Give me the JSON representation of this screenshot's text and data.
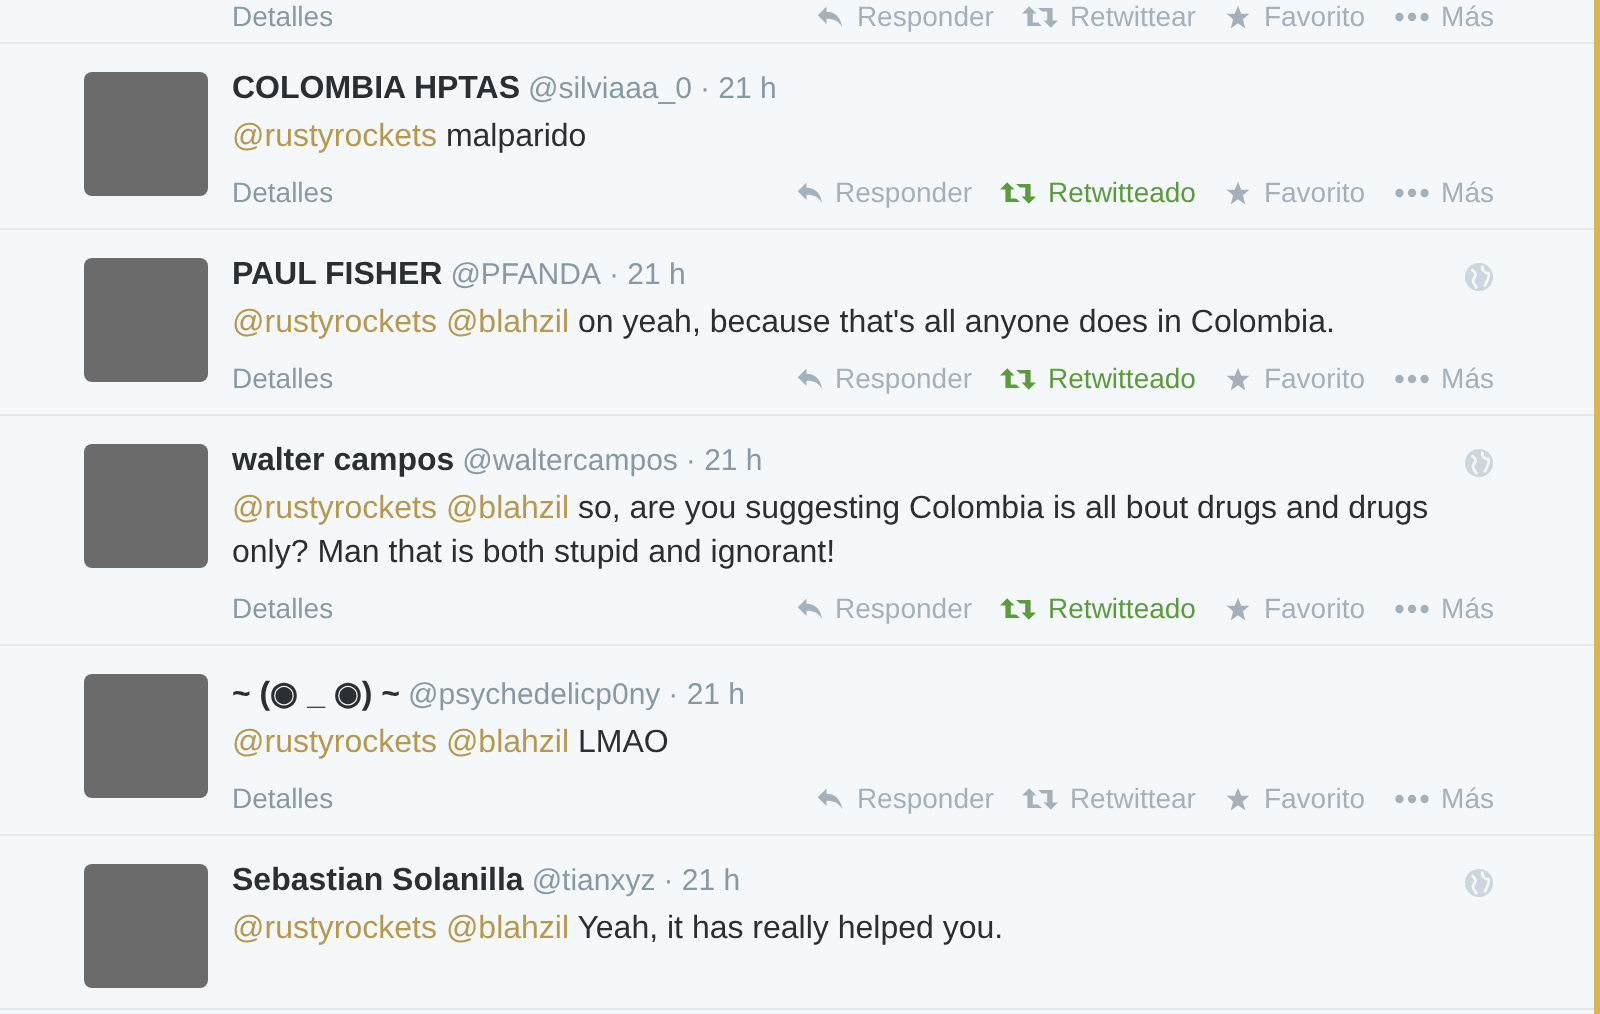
{
  "top_row": {
    "details": "Detalles",
    "actions": [
      {
        "kind": "reply",
        "label": "Responder",
        "active": false
      },
      {
        "kind": "retweet",
        "label": "Retwittear",
        "active": false
      },
      {
        "kind": "favorite",
        "label": "Favorito",
        "active": false
      },
      {
        "kind": "more",
        "label": "Más",
        "active": false
      }
    ]
  },
  "tweets": [
    {
      "name": "COLOMBIA HPTAS",
      "handle": "@silviaaa_0",
      "time": "· 21 h",
      "mentions": [
        "@rustyrockets"
      ],
      "text": "malparido",
      "details": "Detalles",
      "actions": [
        {
          "kind": "reply",
          "label": "Responder",
          "active": false
        },
        {
          "kind": "retweet",
          "label": "Retwitteado",
          "active": true
        },
        {
          "kind": "favorite",
          "label": "Favorito",
          "active": false
        },
        {
          "kind": "more",
          "label": "Más",
          "active": false
        }
      ]
    },
    {
      "name": "PAUL FISHER",
      "handle": "@PFANDA",
      "time": "· 21 h",
      "globe": true,
      "mentions": [
        "@rustyrockets",
        "@blahzil"
      ],
      "text": "on yeah, because that's all anyone does in Colombia.",
      "details": "Detalles",
      "actions": [
        {
          "kind": "reply",
          "label": "Responder",
          "active": false
        },
        {
          "kind": "retweet",
          "label": "Retwitteado",
          "active": true
        },
        {
          "kind": "favorite",
          "label": "Favorito",
          "active": false
        },
        {
          "kind": "more",
          "label": "Más",
          "active": false
        }
      ]
    },
    {
      "name": "walter campos",
      "handle": "@waltercampos",
      "time": "· 21 h",
      "globe": true,
      "mentions": [
        "@rustyrockets",
        "@blahzil"
      ],
      "text": "so, are you suggesting Colombia is all bout drugs and drugs only? Man that is both stupid and ignorant!",
      "details": "Detalles",
      "actions": [
        {
          "kind": "reply",
          "label": "Responder",
          "active": false
        },
        {
          "kind": "retweet",
          "label": "Retwitteado",
          "active": true
        },
        {
          "kind": "favorite",
          "label": "Favorito",
          "active": false
        },
        {
          "kind": "more",
          "label": "Más",
          "active": false
        }
      ]
    },
    {
      "name": "~ (◉ _ ◉) ~",
      "handle": "@psychedelicp0ny",
      "time": "· 21 h",
      "mentions": [
        "@rustyrockets",
        "@blahzil"
      ],
      "text": "LMAO",
      "details": "Detalles",
      "actions": [
        {
          "kind": "reply",
          "label": "Responder",
          "active": false
        },
        {
          "kind": "retweet",
          "label": "Retwittear",
          "active": false
        },
        {
          "kind": "favorite",
          "label": "Favorito",
          "active": false
        },
        {
          "kind": "more",
          "label": "Más",
          "active": false
        }
      ]
    },
    {
      "name": "Sebastian Solanilla",
      "handle": "@tianxyz",
      "time": "· 21 h",
      "globe": true,
      "mentions": [
        "@rustyrockets",
        "@blahzil"
      ],
      "text": "Yeah, it has really helped you."
    }
  ]
}
